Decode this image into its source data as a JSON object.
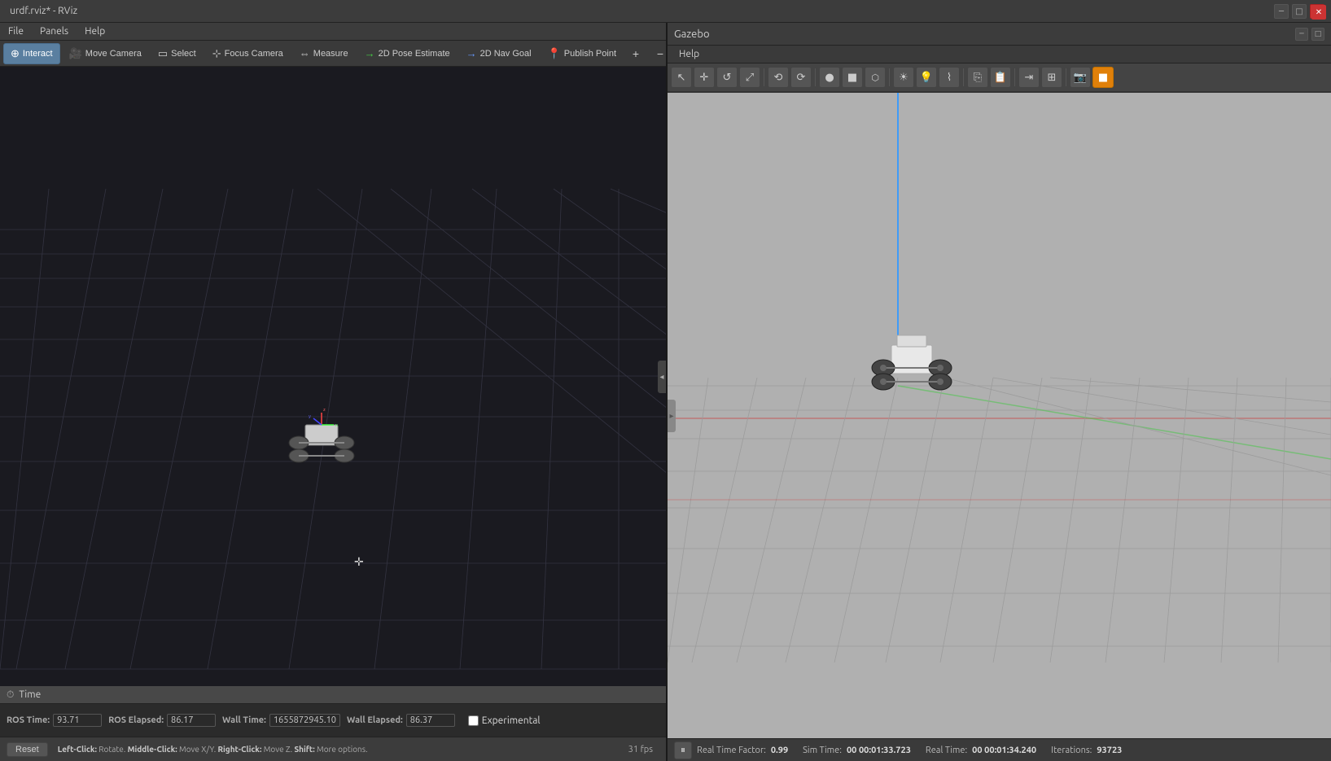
{
  "rviz": {
    "window_title": "urdf.rviz* - RViz",
    "menubar": {
      "items": [
        "File",
        "Panels",
        "Help"
      ]
    },
    "toolbar": {
      "tools": [
        {
          "id": "interact",
          "label": "Interact",
          "icon": "⊕",
          "active": true
        },
        {
          "id": "move_camera",
          "label": "Move Camera",
          "icon": "📷",
          "active": false
        },
        {
          "id": "select",
          "label": "Select",
          "icon": "▭",
          "active": false
        },
        {
          "id": "focus_camera",
          "label": "Focus Camera",
          "icon": "⊹",
          "active": false
        },
        {
          "id": "measure",
          "label": "Measure",
          "icon": "⇔",
          "active": false
        },
        {
          "id": "pose_estimate",
          "label": "2D Pose Estimate",
          "icon": "→",
          "active": false
        },
        {
          "id": "nav_goal",
          "label": "2D Nav Goal",
          "icon": "→",
          "active": false
        },
        {
          "id": "publish_point",
          "label": "Publish Point",
          "icon": "📍",
          "active": false
        }
      ],
      "icons": {
        "plus": "+",
        "minus": "−",
        "circle": "◉"
      }
    },
    "time_panel": {
      "title": "Time",
      "ros_time_label": "ROS Time:",
      "ros_time_value": "93.71",
      "ros_elapsed_label": "ROS Elapsed:",
      "ros_elapsed_value": "86.17",
      "wall_time_label": "Wall Time:",
      "wall_time_value": "1655872945.10",
      "wall_elapsed_label": "Wall Elapsed:",
      "wall_elapsed_value": "86.37",
      "experimental_label": "Experimental",
      "reset_label": "Reset",
      "hint": "Left-Click: Rotate. Middle-Click: Move X/Y. Right-Click: Move Z. Shift: More options.",
      "fps": "31 fps"
    }
  },
  "gazebo": {
    "window_title": "Gazebo",
    "menubar": {
      "items": [
        "Help"
      ]
    },
    "toolbar": {
      "tool_icons": [
        "🔧",
        "✛",
        "↺",
        "▭",
        "✎",
        "⟲",
        "⟳",
        "●",
        "■",
        "🔷",
        "☀",
        "💡",
        "⌇",
        "▮",
        "▯",
        "⇥",
        "⇤",
        "↕",
        "⌛",
        "📷",
        "⊞"
      ]
    },
    "statusbar": {
      "real_time_factor_label": "Real Time Factor:",
      "real_time_factor_value": "0.99",
      "sim_time_label": "Sim Time:",
      "sim_time_value": "00 00:01:33.723",
      "real_time_label": "Real Time:",
      "real_time_value": "00 00:01:34.240",
      "iterations_label": "Iterations:",
      "iterations_value": "93723"
    }
  }
}
